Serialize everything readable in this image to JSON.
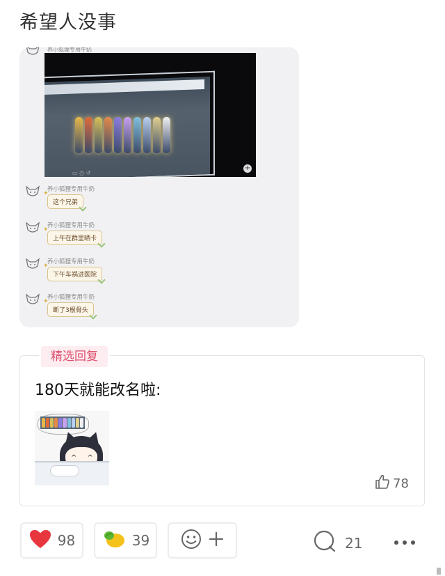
{
  "post": {
    "title": "希望人没事"
  },
  "chat_screenshot": {
    "sender_name": "养小狐狸专用牛奶",
    "messages": [
      {
        "name": "养小狐狸专用牛奶",
        "text": "这个兄弟"
      },
      {
        "name": "养小狐狸专用牛奶",
        "text": "上午在群里晒卡"
      },
      {
        "name": "养小狐狸专用牛奶",
        "text": "下午车祸进医院"
      },
      {
        "name": "养小狐狸专用牛奶",
        "text": "断了3根骨头"
      }
    ],
    "card_colors": [
      "#e8b84a",
      "#e06a3a",
      "#d9c056",
      "#e58a4a",
      "#8a7ce0",
      "#c8a0f0",
      "#7fc0e0",
      "#b8d0f0",
      "#e0d090",
      "#f0f0f0"
    ]
  },
  "selected_reply": {
    "tag": "精选回复",
    "text": "180天就能改名啦:",
    "likes": "78"
  },
  "actions": {
    "love_count": "98",
    "lemon_count": "39",
    "comment_count": "21"
  },
  "colors": {
    "tag_bg": "#fdecf0",
    "tag_text": "#e0506e",
    "heart": "#e8363f",
    "lemon": "#f4c21b"
  }
}
